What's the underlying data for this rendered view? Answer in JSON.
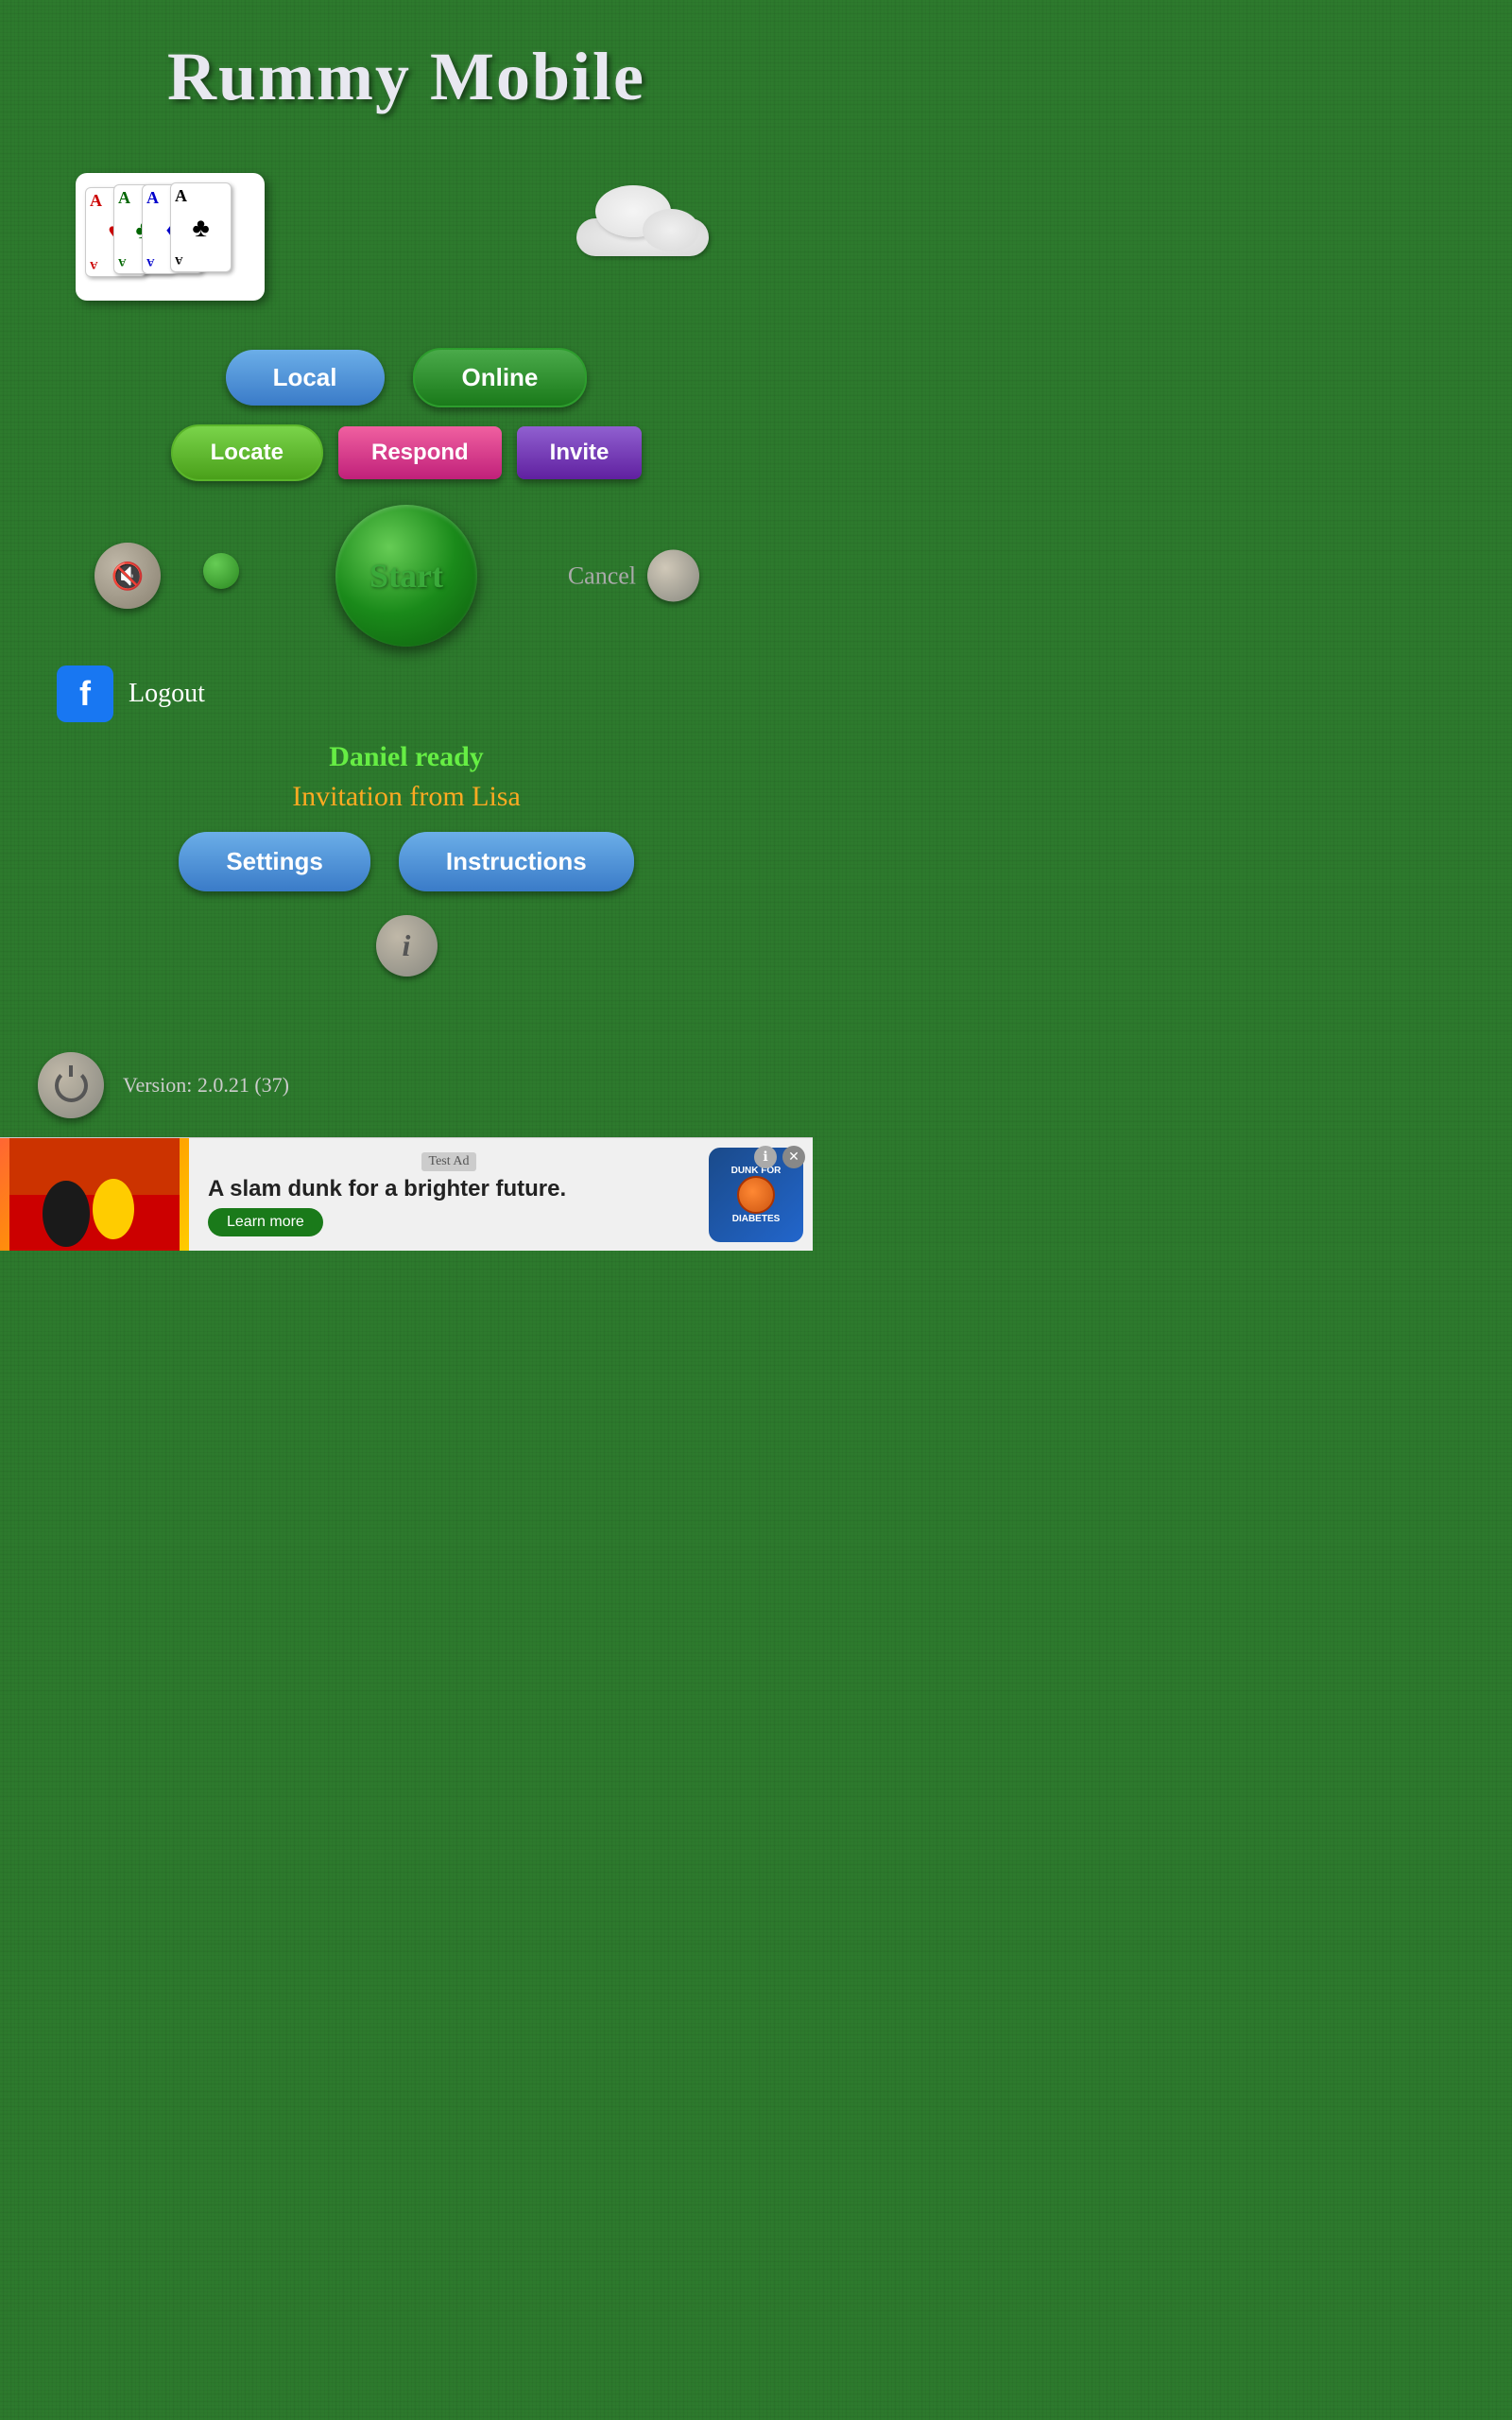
{
  "app": {
    "title": "Rummy Mobile"
  },
  "cards": [
    {
      "label": "A",
      "suit": "♥",
      "color": "red"
    },
    {
      "label": "A",
      "suit": "♣",
      "color": "green"
    },
    {
      "label": "A",
      "suit": "♦",
      "color": "blue"
    },
    {
      "label": "A",
      "suit": "♣",
      "color": "black"
    }
  ],
  "buttons": {
    "local": "Local",
    "online": "Online",
    "locate": "Locate",
    "respond": "Respond",
    "invite": "Invite",
    "start": "Start",
    "cancel": "Cancel",
    "logout": "Logout",
    "settings": "Settings",
    "instructions": "Instructions"
  },
  "status": {
    "player_ready": "Daniel ready",
    "invitation": "Invitation from Lisa"
  },
  "version": {
    "text": "Version: 2.0.21 (37)"
  },
  "ad": {
    "test_label": "Test Ad",
    "headline": "A slam dunk for a brighter future.",
    "learn_more": "Learn more",
    "badge_top": "DUNK FOR",
    "badge_bottom": "DIABETES"
  }
}
